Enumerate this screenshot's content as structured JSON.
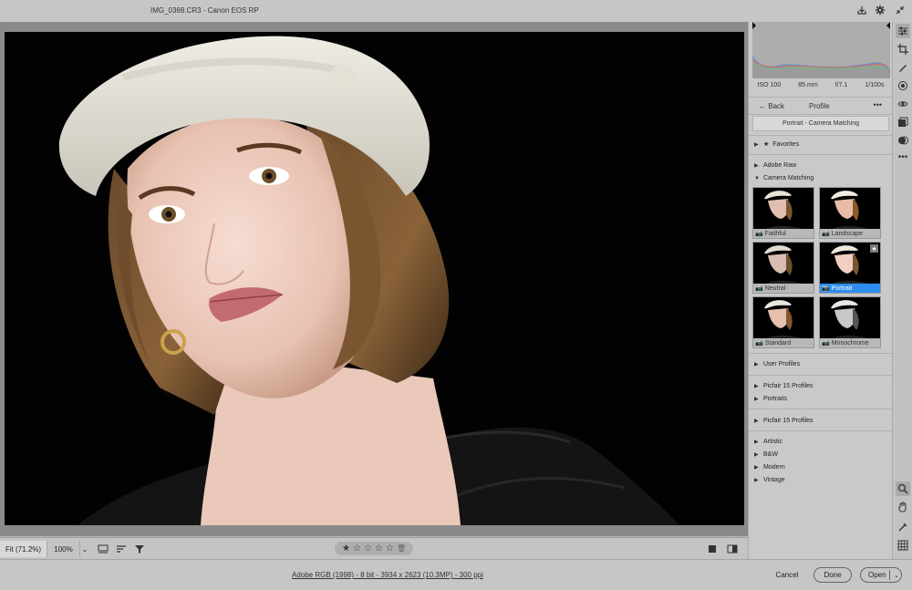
{
  "window": {
    "title": "IMG_0369.CR3  -  Canon EOS RP"
  },
  "titlebar_icons": [
    "export-icon",
    "gear-icon",
    "collapse-icon"
  ],
  "image_toolbar": {
    "zoom_fit": "Fit (71.2%)",
    "zoom_100": "100%",
    "stars": [
      "★",
      "☆",
      "☆",
      "☆",
      "☆"
    ]
  },
  "status": {
    "info": "Adobe RGB (1998) - 8 bit - 3934 x 2623 (10.3MP) - 300 ppi"
  },
  "buttons": {
    "cancel": "Cancel",
    "done": "Done",
    "open": "Open"
  },
  "camera_info": {
    "iso": "ISO 100",
    "focal": "85 mm",
    "aperture": "f/7.1",
    "shutter": "1/100s"
  },
  "profile_panel": {
    "back": "Back",
    "title": "Profile",
    "more": "•••",
    "selected_profile": "Portrait - Camera Matching",
    "favorites": "Favorites",
    "adobe_raw": "Adobe Raw",
    "camera_matching": "Camera Matching",
    "thumbnails": [
      {
        "label": "Faithful",
        "selected": false
      },
      {
        "label": "Landscape",
        "selected": false
      },
      {
        "label": "Neutral",
        "selected": false
      },
      {
        "label": "Portrait",
        "selected": true
      },
      {
        "label": "Standard",
        "selected": false
      },
      {
        "label": "Monochrome",
        "selected": false
      }
    ],
    "user_profiles": "User Profiles",
    "picfair1": "Picfair 15 Profiles",
    "portraits": "Portraits",
    "picfair2": "Picfair 15 Profiles",
    "artistic": "Artistic",
    "bw": "B&W",
    "modern": "Modern",
    "vintage": "Vintage"
  },
  "colors": {
    "accent": "#2d8ef0",
    "panel_bg": "#c9c9c9",
    "canvas_bg": "#8a8a8a"
  }
}
